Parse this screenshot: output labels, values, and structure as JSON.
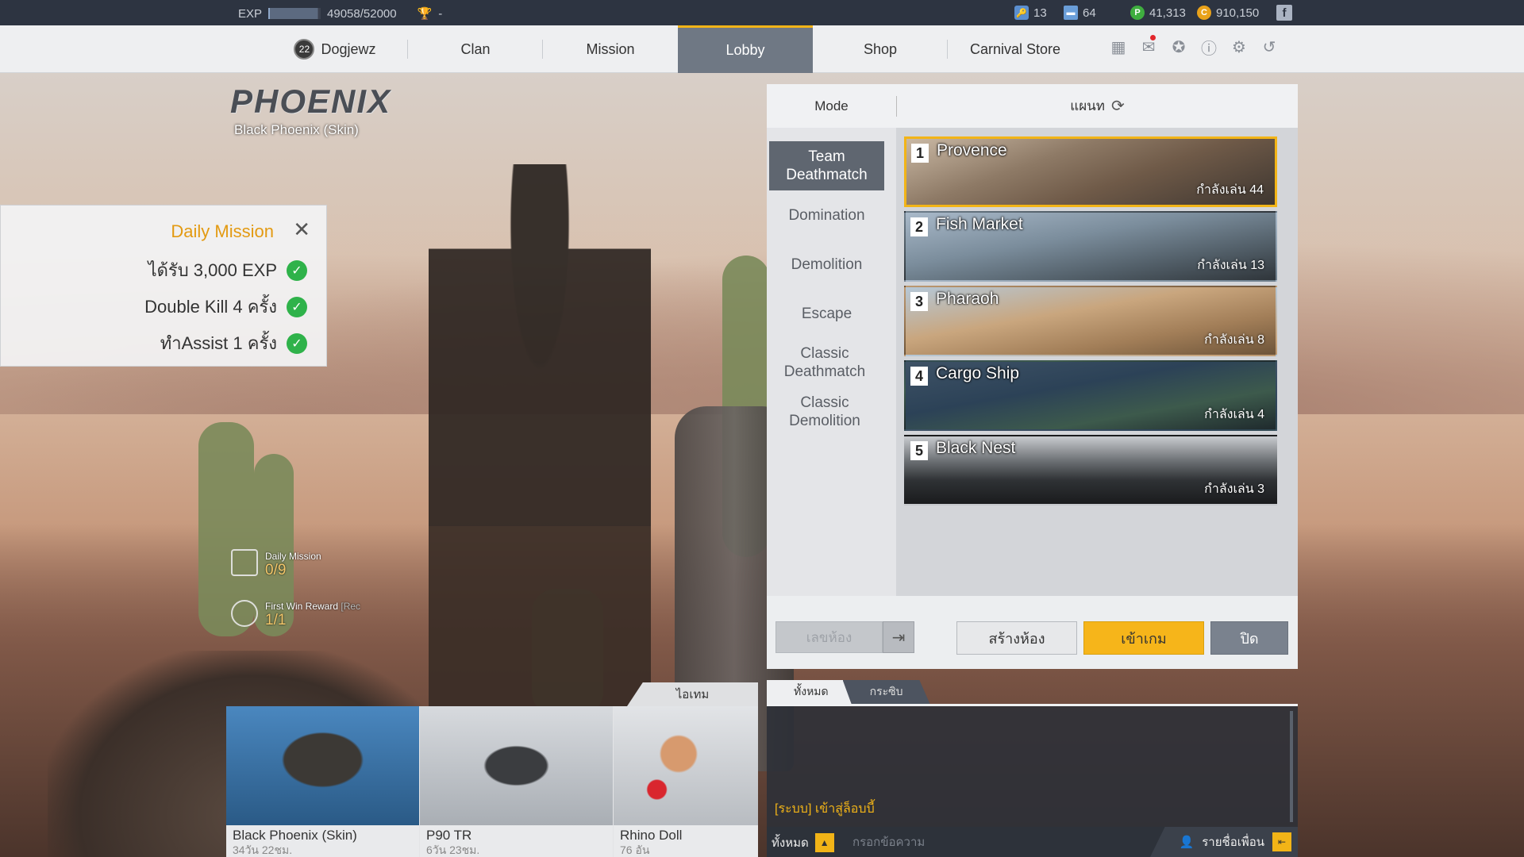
{
  "status": {
    "exp_label": "EXP",
    "exp_value": "49058/52000",
    "exp_progress": 0.943,
    "trophy_value": "-",
    "keys": "13",
    "folders": "64",
    "points": "41,313",
    "coins": "910,150"
  },
  "nav": {
    "level": "22",
    "username": "Dogjewz",
    "items": [
      "Clan",
      "Mission",
      "Lobby",
      "Shop",
      "Carnival Store"
    ],
    "active": "Lobby"
  },
  "character": {
    "title": "PHOENIX",
    "subtitle": "Black Phoenix (Skin)"
  },
  "daily_mission": {
    "title": "Daily Mission",
    "tasks": [
      {
        "text": "ได้รับ 3,000 EXP",
        "done": true
      },
      {
        "text": "Double Kill 4 ครั้ง",
        "done": true
      },
      {
        "text": "ทำAssist 1 ครั้ง",
        "done": true
      }
    ]
  },
  "indicators": {
    "daily_label": "Daily Mission",
    "daily_value": "0/9",
    "firstwin_label": "First Win Reward",
    "firstwin_extra": "[Rec",
    "firstwin_value": "1/1"
  },
  "panel": {
    "mode_header": "Mode",
    "map_header": "แผนท",
    "modes": [
      "Team Deathmatch",
      "Domination",
      "Demolition",
      "Escape",
      "Classic Deathmatch",
      "Classic Demolition"
    ],
    "active_mode": "Team Deathmatch",
    "maps": [
      {
        "num": "1",
        "name": "Provence",
        "count": "กำลังเล่น 44",
        "selected": true
      },
      {
        "num": "2",
        "name": "Fish Market",
        "count": "กำลังเล่น 13",
        "selected": false
      },
      {
        "num": "3",
        "name": "Pharaoh",
        "count": "กำลังเล่น 8",
        "selected": false
      },
      {
        "num": "4",
        "name": "Cargo Ship",
        "count": "กำลังเล่น 4",
        "selected": false
      },
      {
        "num": "5",
        "name": "Black Nest",
        "count": "กำลังเล่น 3",
        "selected": false
      }
    ],
    "room_placeholder": "เลขห้อง",
    "create_label": "สร้างห้อง",
    "enter_label": "เข้าเกม",
    "close_label": "ปิด"
  },
  "items": {
    "tab_label": "ไอเทม",
    "list": [
      {
        "name": "Black Phoenix (Skin)",
        "sub": "34วัน 22ชม."
      },
      {
        "name": "P90 TR",
        "sub": "6วัน 23ชม."
      },
      {
        "name": "Rhino Doll",
        "sub": "76 อัน"
      }
    ]
  },
  "chat": {
    "tab_all": "ทั้งหมด",
    "tab_whisper": "กระซิบ",
    "message": "[ระบบ] เข้าสู่ล็อบบี้",
    "scope": "ทั้งหมด",
    "input_placeholder": "กรอกข้อความ",
    "friends_label": "รายชื่อเพื่อน"
  },
  "colors": {
    "accent": "#f2b417",
    "nav_active": "#6f7884",
    "check": "#2fb24a"
  }
}
